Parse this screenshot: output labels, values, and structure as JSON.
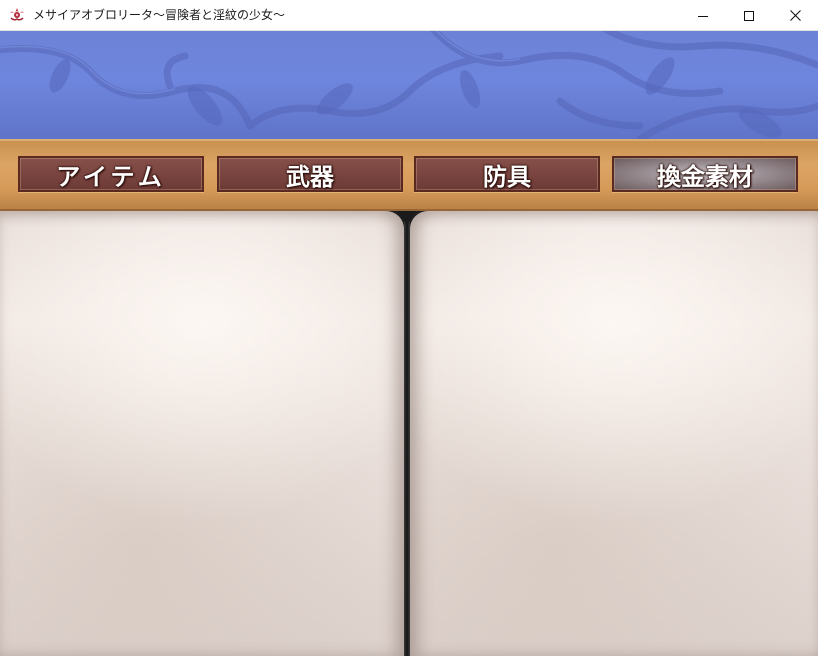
{
  "window": {
    "title": "メサイアオブロリータ～冒険者と淫紋の少女～",
    "icon": "app-emblem-icon",
    "controls": {
      "minimize_icon": "minimize-icon",
      "maximize_icon": "maximize-icon",
      "close_icon": "close-icon"
    }
  },
  "menu": {
    "tabs": [
      {
        "label": "アイテム"
      },
      {
        "label": "武器"
      },
      {
        "label": "防具"
      },
      {
        "label": "換金素材"
      }
    ]
  },
  "colors": {
    "banner_blue": "#6f86de",
    "tabbar_wood": "#dca464",
    "tab_brown": "#7a4540",
    "page_parchment": "#f1e8e3"
  }
}
